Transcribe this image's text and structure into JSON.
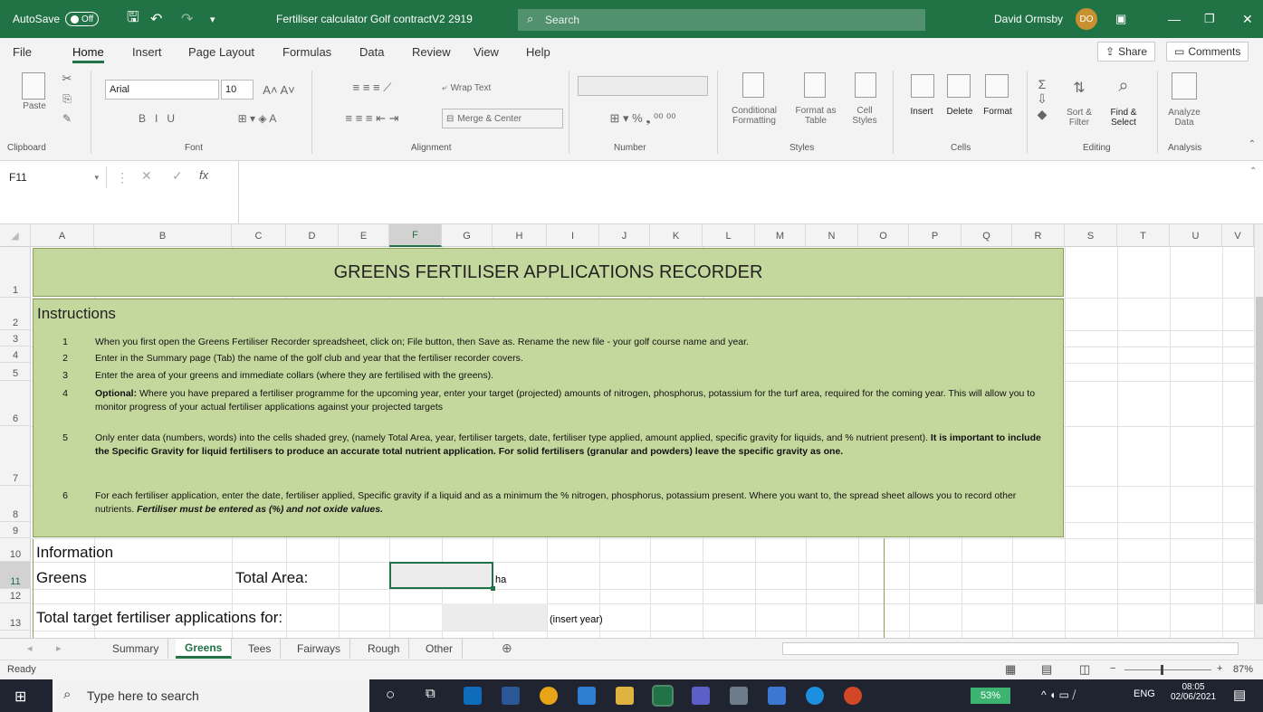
{
  "titlebar": {
    "autosave_label": "AutoSave",
    "autosave_state": "Off",
    "filename": "Fertiliser calculator Golf contractV2 2919",
    "search_placeholder": "Search",
    "user_name": "David Ormsby",
    "user_initials": "DO"
  },
  "menu": {
    "tabs": [
      "File",
      "Home",
      "Insert",
      "Page Layout",
      "Formulas",
      "Data",
      "Review",
      "View",
      "Help"
    ],
    "active_tab": "Home",
    "share": "Share",
    "comments": "Comments"
  },
  "ribbon": {
    "clipboard": {
      "paste": "Paste",
      "label": "Clipboard"
    },
    "font": {
      "name": "Arial",
      "size": "10",
      "label": "Font"
    },
    "alignment": {
      "wrap": "Wrap Text",
      "merge": "Merge & Center",
      "label": "Alignment"
    },
    "number": {
      "format": "",
      "label": "Number"
    },
    "styles": {
      "conditional": "Conditional Formatting",
      "format_table": "Format as Table",
      "cell_styles": "Cell Styles",
      "label": "Styles"
    },
    "cells": {
      "insert": "Insert",
      "delete": "Delete",
      "format": "Format",
      "label": "Cells"
    },
    "editing": {
      "sort": "Sort & Filter",
      "find": "Find & Select",
      "label": "Editing"
    },
    "analysis": {
      "analyze": "Analyze Data",
      "label": "Analysis"
    }
  },
  "formula_bar": {
    "name_box": "F11",
    "fx": "fx",
    "content": ""
  },
  "columns": [
    "A",
    "B",
    "C",
    "D",
    "E",
    "F",
    "G",
    "H",
    "I",
    "J",
    "K",
    "L",
    "M",
    "N",
    "O",
    "P",
    "Q",
    "R",
    "S",
    "T",
    "U",
    "V"
  ],
  "selected_column": "F",
  "rows": [
    "1",
    "2",
    "3",
    "4",
    "5",
    "6",
    "7",
    "8",
    "9",
    "10",
    "11",
    "12",
    "13"
  ],
  "selected_row": "11",
  "sheet": {
    "title": "GREENS FERTILISER APPLICATIONS RECORDER",
    "instructions_heading": "Instructions",
    "instructions": [
      {
        "n": "1",
        "text": "When you first open the Greens Fertiliser Recorder spreadsheet, click on; File button, then  Save as. Rename the new file - your golf course name and year."
      },
      {
        "n": "2",
        "text": "Enter in the Summary page (Tab) the name of the golf club and year that the fertiliser recorder covers."
      },
      {
        "n": "3",
        "text": "Enter the area of your greens and immediate collars (where they are fertilised with the greens)."
      },
      {
        "n": "4",
        "bold": "Optional:",
        "text": " Where you have prepared a fertiliser programme for the upcoming year, enter your target (projected) amounts of nitrogen, phosphorus, potassium for the turf area, required for the coming year. This will allow you to monitor progress of your actual fertiliser applications against your projected targets"
      },
      {
        "n": "5",
        "text": "Only enter data (numbers, words) into the cells shaded grey, (namely Total Area, year, fertiliser targets, date, fertiliser type applied, amount applied, specific gravity for liquids, and % nutrient present). ",
        "bold": "It is important to include the Specific Gravity for liquid fertilisers to produce an accurate total nutrient application. For solid fertilisers (granular and powders) leave the specific gravity as one."
      },
      {
        "n": "6",
        "text": "For each fertiliser application, enter the date, fertiliser applied, Specific gravity if a liquid and as a minimum the % nitrogen, phosphorus, potassium present. Where you want to, the spread sheet allows you to record other nutrients. ",
        "bold": "Fertiliser must be entered as (%) and not oxide values."
      }
    ],
    "information": "Information",
    "greens": "Greens",
    "total_area": "Total Area:",
    "ha": "ha",
    "total_target": "Total target fertiliser applications for:",
    "insert_year": "(insert year)"
  },
  "sheet_tabs": [
    "Summary",
    "Greens",
    "Tees",
    "Fairways",
    "Rough",
    "Other"
  ],
  "active_sheet": "Greens",
  "status": {
    "ready": "Ready",
    "zoom": "87%"
  },
  "taskbar": {
    "search": "Type here to search",
    "battery": "53%",
    "lang": "ENG",
    "time": "08:05",
    "date": "02/06/2021"
  }
}
